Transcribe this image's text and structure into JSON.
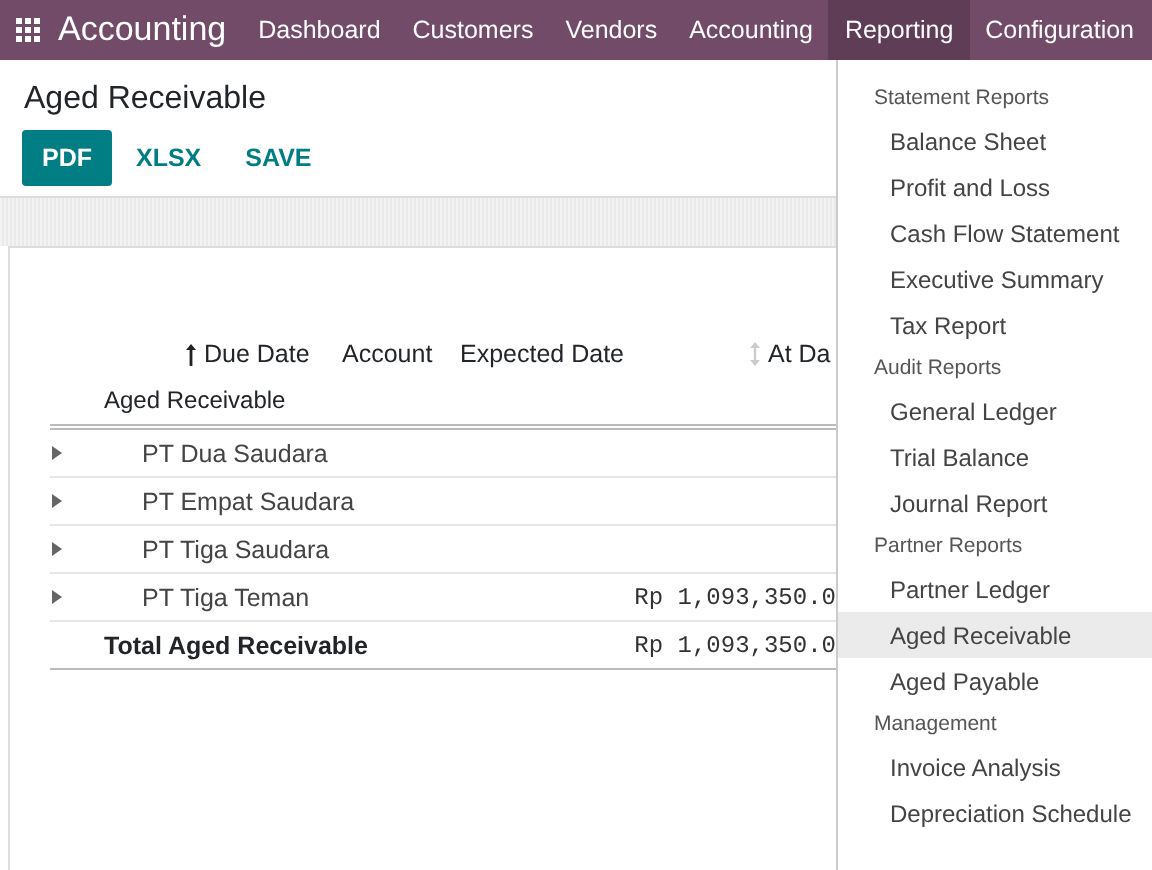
{
  "navbar": {
    "app_name": "Accounting",
    "items": [
      {
        "label": "Dashboard",
        "selected": false
      },
      {
        "label": "Customers",
        "selected": false
      },
      {
        "label": "Vendors",
        "selected": false
      },
      {
        "label": "Accounting",
        "selected": false
      },
      {
        "label": "Reporting",
        "selected": true
      },
      {
        "label": "Configuration",
        "selected": false
      }
    ]
  },
  "page": {
    "title": "Aged Receivable",
    "buttons": [
      {
        "label": "PDF",
        "kind": "primary"
      },
      {
        "label": "XLSX",
        "kind": "link"
      },
      {
        "label": "SAVE",
        "kind": "link"
      }
    ]
  },
  "table": {
    "columns": [
      {
        "label": "Due Date",
        "kind": "sorted"
      },
      {
        "label": "Account",
        "kind": "plain"
      },
      {
        "label": "Expected Date",
        "kind": "plain"
      },
      {
        "label": "At Da",
        "kind": "sortable"
      }
    ],
    "subheader": "Aged Receivable",
    "rows": [
      {
        "name": "PT Dua Saudara",
        "amount": "",
        "expanded": false
      },
      {
        "name": "PT Empat Saudara",
        "amount": "",
        "expanded": false
      },
      {
        "name": "PT Tiga Saudara",
        "amount": "",
        "expanded": false
      },
      {
        "name": "PT Tiga Teman",
        "amount": "Rp 1,093,350.0",
        "expanded": false
      }
    ],
    "total": {
      "label": "Total Aged Receivable",
      "amount": "Rp 1,093,350.0"
    }
  },
  "dropdown": {
    "sections": [
      {
        "title": "Statement Reports",
        "items": [
          {
            "label": "Balance Sheet",
            "selected": false
          },
          {
            "label": "Profit and Loss",
            "selected": false
          },
          {
            "label": "Cash Flow Statement",
            "selected": false
          },
          {
            "label": "Executive Summary",
            "selected": false
          },
          {
            "label": "Tax Report",
            "selected": false
          }
        ]
      },
      {
        "title": "Audit Reports",
        "items": [
          {
            "label": "General Ledger",
            "selected": false
          },
          {
            "label": "Trial Balance",
            "selected": false
          },
          {
            "label": "Journal Report",
            "selected": false
          }
        ]
      },
      {
        "title": "Partner Reports",
        "items": [
          {
            "label": "Partner Ledger",
            "selected": false
          },
          {
            "label": "Aged Receivable",
            "selected": true
          },
          {
            "label": "Aged Payable",
            "selected": false
          }
        ]
      },
      {
        "title": "Management",
        "items": [
          {
            "label": "Invoice Analysis",
            "selected": false
          },
          {
            "label": "Depreciation Schedule",
            "selected": false
          }
        ]
      }
    ]
  }
}
